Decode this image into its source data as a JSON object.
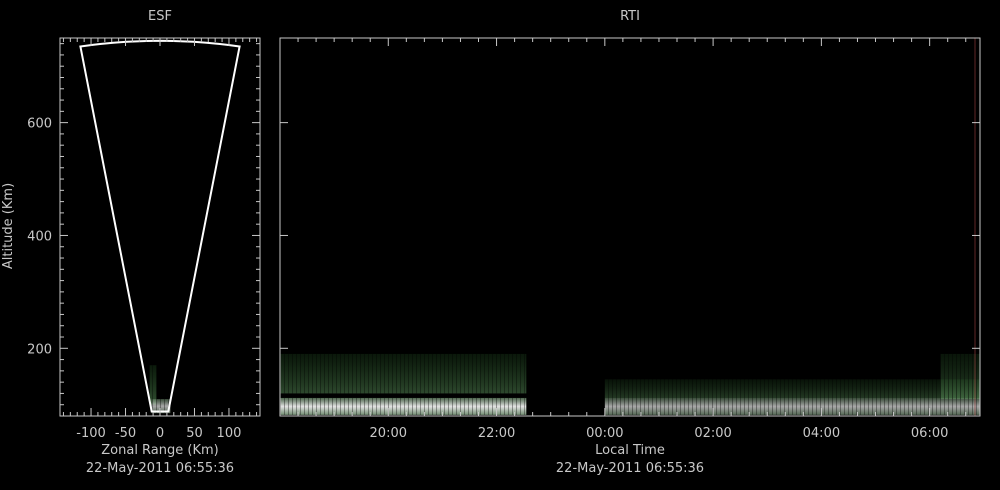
{
  "colors": {
    "background": "#000000",
    "axis": "#c8c8c8",
    "fan_outline": "#ffffff",
    "echo_green": "#4c9a4c",
    "echo_white": "#e8e8e8",
    "right_edge": "#a04040"
  },
  "chart_data": [
    {
      "id": "esf",
      "type": "heatmap",
      "title": "ESF",
      "xlabel": "Zonal Range (Km)",
      "ylabel": "Altitude (Km)",
      "xlim": [
        -145,
        145
      ],
      "ylim": [
        80,
        750
      ],
      "x_ticks": [
        -100,
        -50,
        0,
        50,
        100
      ],
      "x_tick_labels": [
        "-100",
        "-50",
        "0",
        "50",
        "100"
      ],
      "y_ticks": [
        200,
        400,
        600
      ],
      "y_tick_labels": [
        "200",
        "400",
        "600"
      ],
      "timestamp": "22-May-2011 06:55:36",
      "fan": {
        "apex_altitude": 80,
        "top_altitude": 745,
        "half_angle_deg": 10
      },
      "echo_regions": [
        {
          "x": [
            -15,
            -5
          ],
          "y": [
            100,
            170
          ],
          "intensity": 0.5
        },
        {
          "x": [
            -12,
            15
          ],
          "y": [
            85,
            110
          ],
          "intensity": 0.7
        }
      ]
    },
    {
      "id": "rti",
      "type": "heatmap",
      "title": "RTI",
      "xlabel": "Local Time",
      "xlim": [
        18.0,
        30.93
      ],
      "ylim": [
        80,
        750
      ],
      "x_ticks": [
        20,
        22,
        24,
        26,
        28,
        30
      ],
      "x_tick_labels": [
        "20:00",
        "22:00",
        "00:00",
        "02:00",
        "04:00",
        "06:00"
      ],
      "timestamp": "22-May-2011 06:55:36",
      "echo_regions": [
        {
          "t": [
            18.0,
            22.55
          ],
          "y": [
            120,
            190
          ],
          "intensity": 0.45,
          "tone": "green"
        },
        {
          "t": [
            18.0,
            22.55
          ],
          "y": [
            82,
            112
          ],
          "intensity": 0.95,
          "tone": "white"
        },
        {
          "t": [
            24.0,
            30.93
          ],
          "y": [
            82,
            112
          ],
          "intensity": 0.7,
          "tone": "white"
        },
        {
          "t": [
            24.0,
            30.93
          ],
          "y": [
            112,
            145
          ],
          "intensity": 0.35,
          "tone": "green"
        },
        {
          "t": [
            30.2,
            30.93
          ],
          "y": [
            110,
            190
          ],
          "intensity": 0.4,
          "tone": "green"
        }
      ]
    }
  ]
}
